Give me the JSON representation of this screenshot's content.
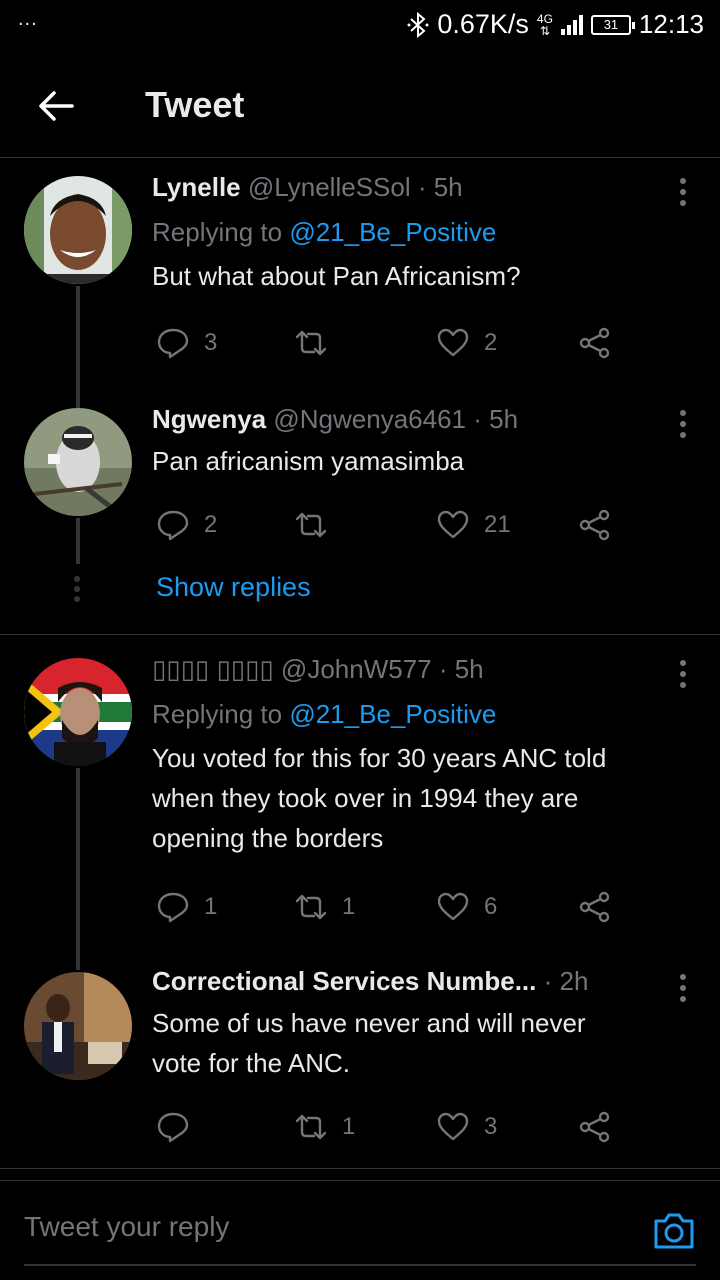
{
  "status_bar": {
    "dots": "...",
    "net_speed": "0.67K/s",
    "network": "4G",
    "battery": "31",
    "time": "12:13"
  },
  "header": {
    "title": "Tweet"
  },
  "tweets": [
    {
      "name": "Lynelle",
      "handle": "@LynelleSSol · 5h",
      "replying_label": "Replying to",
      "replying_to": "@21_Be_Positive",
      "text": "But what about Pan Africanism?",
      "replies": "3",
      "retweets": "",
      "likes": "2"
    },
    {
      "name": "Ngwenya",
      "handle": "@Ngwenya6461 · 5h",
      "text": "Pan africanism yamasimba",
      "replies": "2",
      "retweets": "",
      "likes": "21"
    },
    {
      "name": "▯▯▯▯ ▯▯▯▯",
      "handle": "@JohnW577 · 5h",
      "replying_label": "Replying to",
      "replying_to": "@21_Be_Positive",
      "text": "You voted for this for 30 years ANC told when they took over in 1994 they are opening the borders",
      "replies": "1",
      "retweets": "1",
      "likes": "6"
    },
    {
      "name": "Correctional Services Numbe...",
      "handle": "· 2h",
      "text": "Some of us have never and will never vote for the ANC.",
      "replies": "",
      "retweets": "1",
      "likes": "3"
    }
  ],
  "show_replies": "Show replies",
  "reply_bar": {
    "placeholder": "Tweet your reply"
  },
  "colors": {
    "background": "#000000",
    "accent": "#1d9bf0",
    "muted": "#71767b",
    "text": "#e7e9ea"
  }
}
